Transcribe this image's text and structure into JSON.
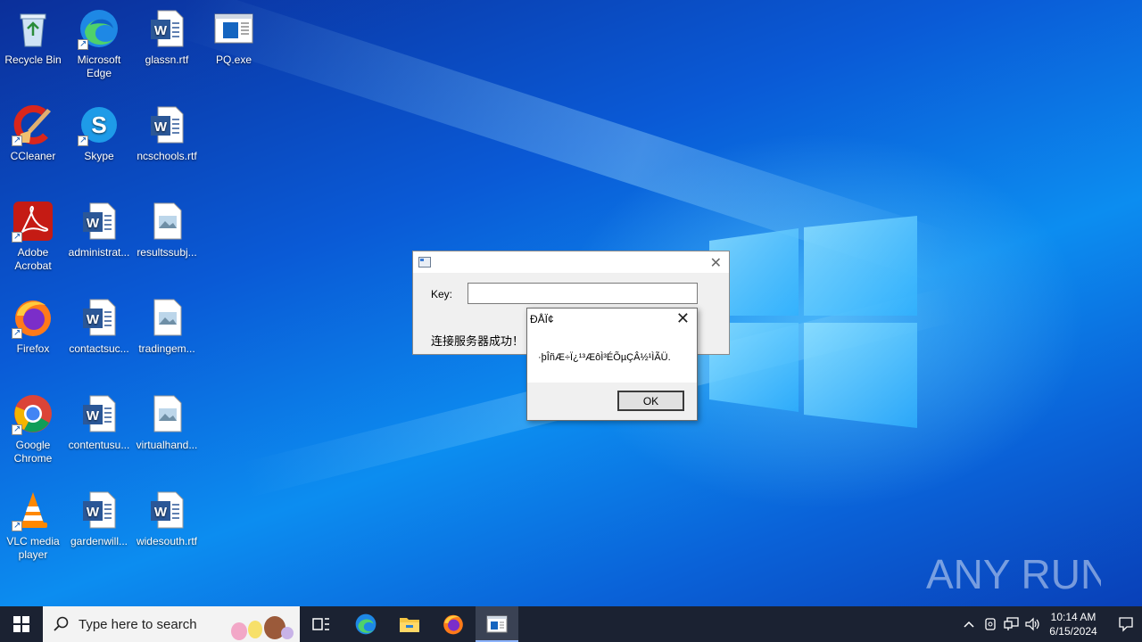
{
  "desktop": {
    "icons": [
      {
        "label": "Recycle Bin",
        "icon": "recycle-bin-icon"
      },
      {
        "label": "Microsoft Edge",
        "icon": "edge-icon"
      },
      {
        "label": "glassn.rtf",
        "icon": "word-document-icon"
      },
      {
        "label": "PQ.exe",
        "icon": "app-window-icon"
      },
      {
        "label": "CCleaner",
        "icon": "ccleaner-icon"
      },
      {
        "label": "Skype",
        "icon": "skype-icon"
      },
      {
        "label": "ncschools.rtf",
        "icon": "word-document-icon"
      },
      {
        "label": "Adobe Acrobat",
        "icon": "acrobat-icon"
      },
      {
        "label": "administrat...",
        "icon": "word-document-icon"
      },
      {
        "label": "resultssubj...",
        "icon": "image-file-icon"
      },
      {
        "label": "Firefox",
        "icon": "firefox-icon"
      },
      {
        "label": "contactsuc...",
        "icon": "word-document-icon"
      },
      {
        "label": "tradingem...",
        "icon": "image-file-icon"
      },
      {
        "label": "Google Chrome",
        "icon": "chrome-icon"
      },
      {
        "label": "contentusu...",
        "icon": "word-document-icon"
      },
      {
        "label": "virtualhand...",
        "icon": "image-file-icon"
      },
      {
        "label": "VLC media player",
        "icon": "vlc-icon"
      },
      {
        "label": "gardenwill...",
        "icon": "word-document-icon"
      },
      {
        "label": "widesouth.rtf",
        "icon": "word-document-icon"
      }
    ]
  },
  "app_window": {
    "key_label": "Key:",
    "key_value": "",
    "status_text": "连接服务器成功！"
  },
  "message_box": {
    "title": "ÐÅÏ¢",
    "text": "·þÎñÆ÷Ï¿¹³ÆôÌ³ÉÕµÇÂ½¹ÌÃÜ.",
    "ok_label": "OK"
  },
  "taskbar": {
    "search_placeholder": "Type here to search",
    "clock_time": "10:14 AM",
    "clock_date": "6/15/2024"
  },
  "watermark": {
    "text": "ANY RUN"
  }
}
